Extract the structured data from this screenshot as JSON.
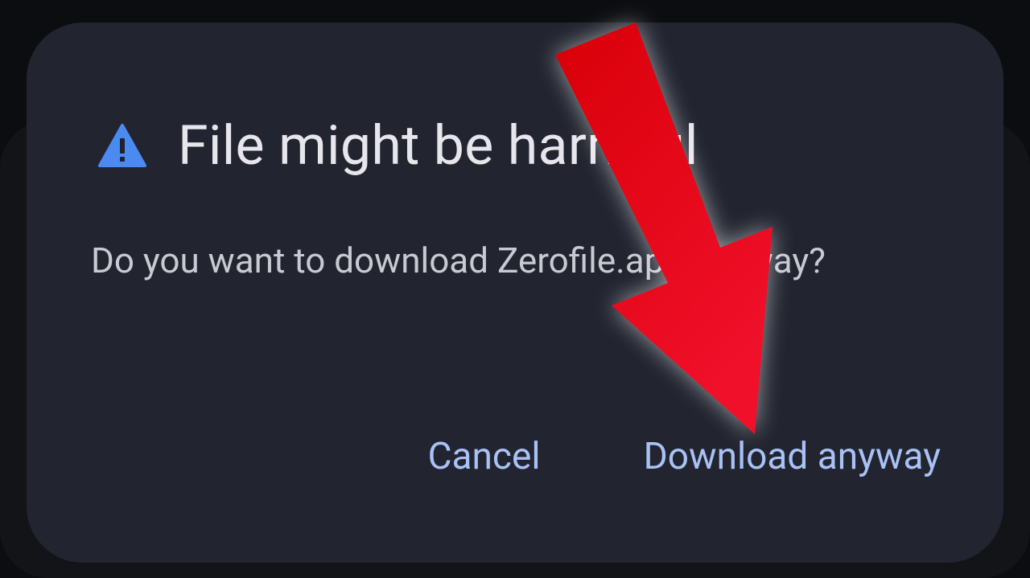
{
  "dialog": {
    "title": "File might be harmful",
    "icon": "warning-triangle-icon",
    "message": "Do you want to download Zerofile.apk anyway?",
    "cancel_label": "Cancel",
    "confirm_label": "Download anyway"
  },
  "colors": {
    "dialog_background": "#222530",
    "title_text": "#e7e6ec",
    "message_text": "#c9c9d1",
    "action_text": "#a9c2f6",
    "warning_icon": "#4b8af0",
    "annotation_arrow": "#e8101c"
  },
  "annotation": {
    "icon": "red-arrow-icon",
    "points_to": "Download anyway"
  }
}
